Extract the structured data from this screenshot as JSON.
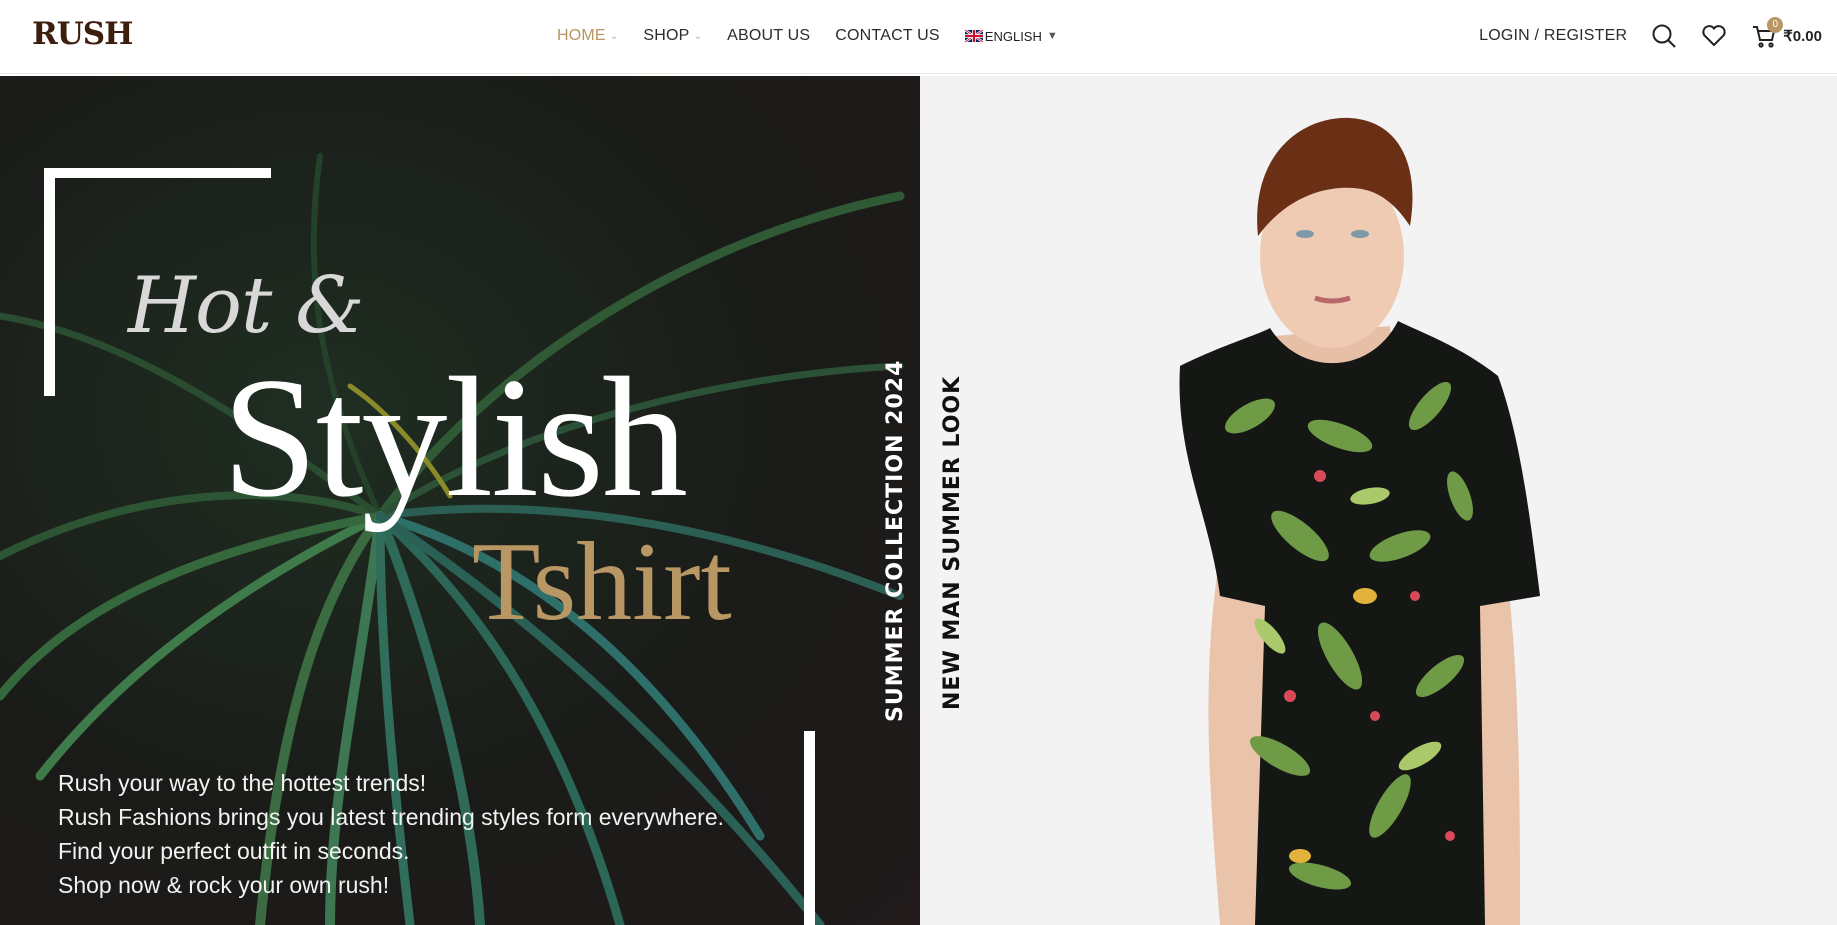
{
  "header": {
    "logo_text": "RUSH",
    "nav": [
      {
        "label": "HOME",
        "has_dropdown": true,
        "active": true
      },
      {
        "label": "SHOP",
        "has_dropdown": true,
        "active": false
      },
      {
        "label": "ABOUT US",
        "has_dropdown": false,
        "active": false
      },
      {
        "label": "CONTACT US",
        "has_dropdown": false,
        "active": false
      }
    ],
    "language": {
      "label": "ENGLISH",
      "flag": "uk-flag-icon"
    },
    "login_label": "LOGIN / REGISTER",
    "icons": [
      "search-icon",
      "heart-icon",
      "cart-icon"
    ],
    "cart_count": "0",
    "cart_amount": "₹0.00"
  },
  "hero": {
    "headline_small": "Hot &",
    "headline_large": "Stylish",
    "headline_accent": "Tshirt",
    "lines": [
      "Rush your way to the hottest trends!",
      "Rush Fashions brings you latest trending styles form everywhere.",
      "Find your perfect outfit in seconds.",
      "Shop now & rock your own rush!"
    ],
    "vertical_label_1": "SUMMER COLLECTION 2024",
    "vertical_label_2": "NEW MAN SUMMER LOOK"
  },
  "colors": {
    "accent": "#b99563",
    "dark_bg": "#1a1b18",
    "right_bg": "#f3f3f3"
  }
}
